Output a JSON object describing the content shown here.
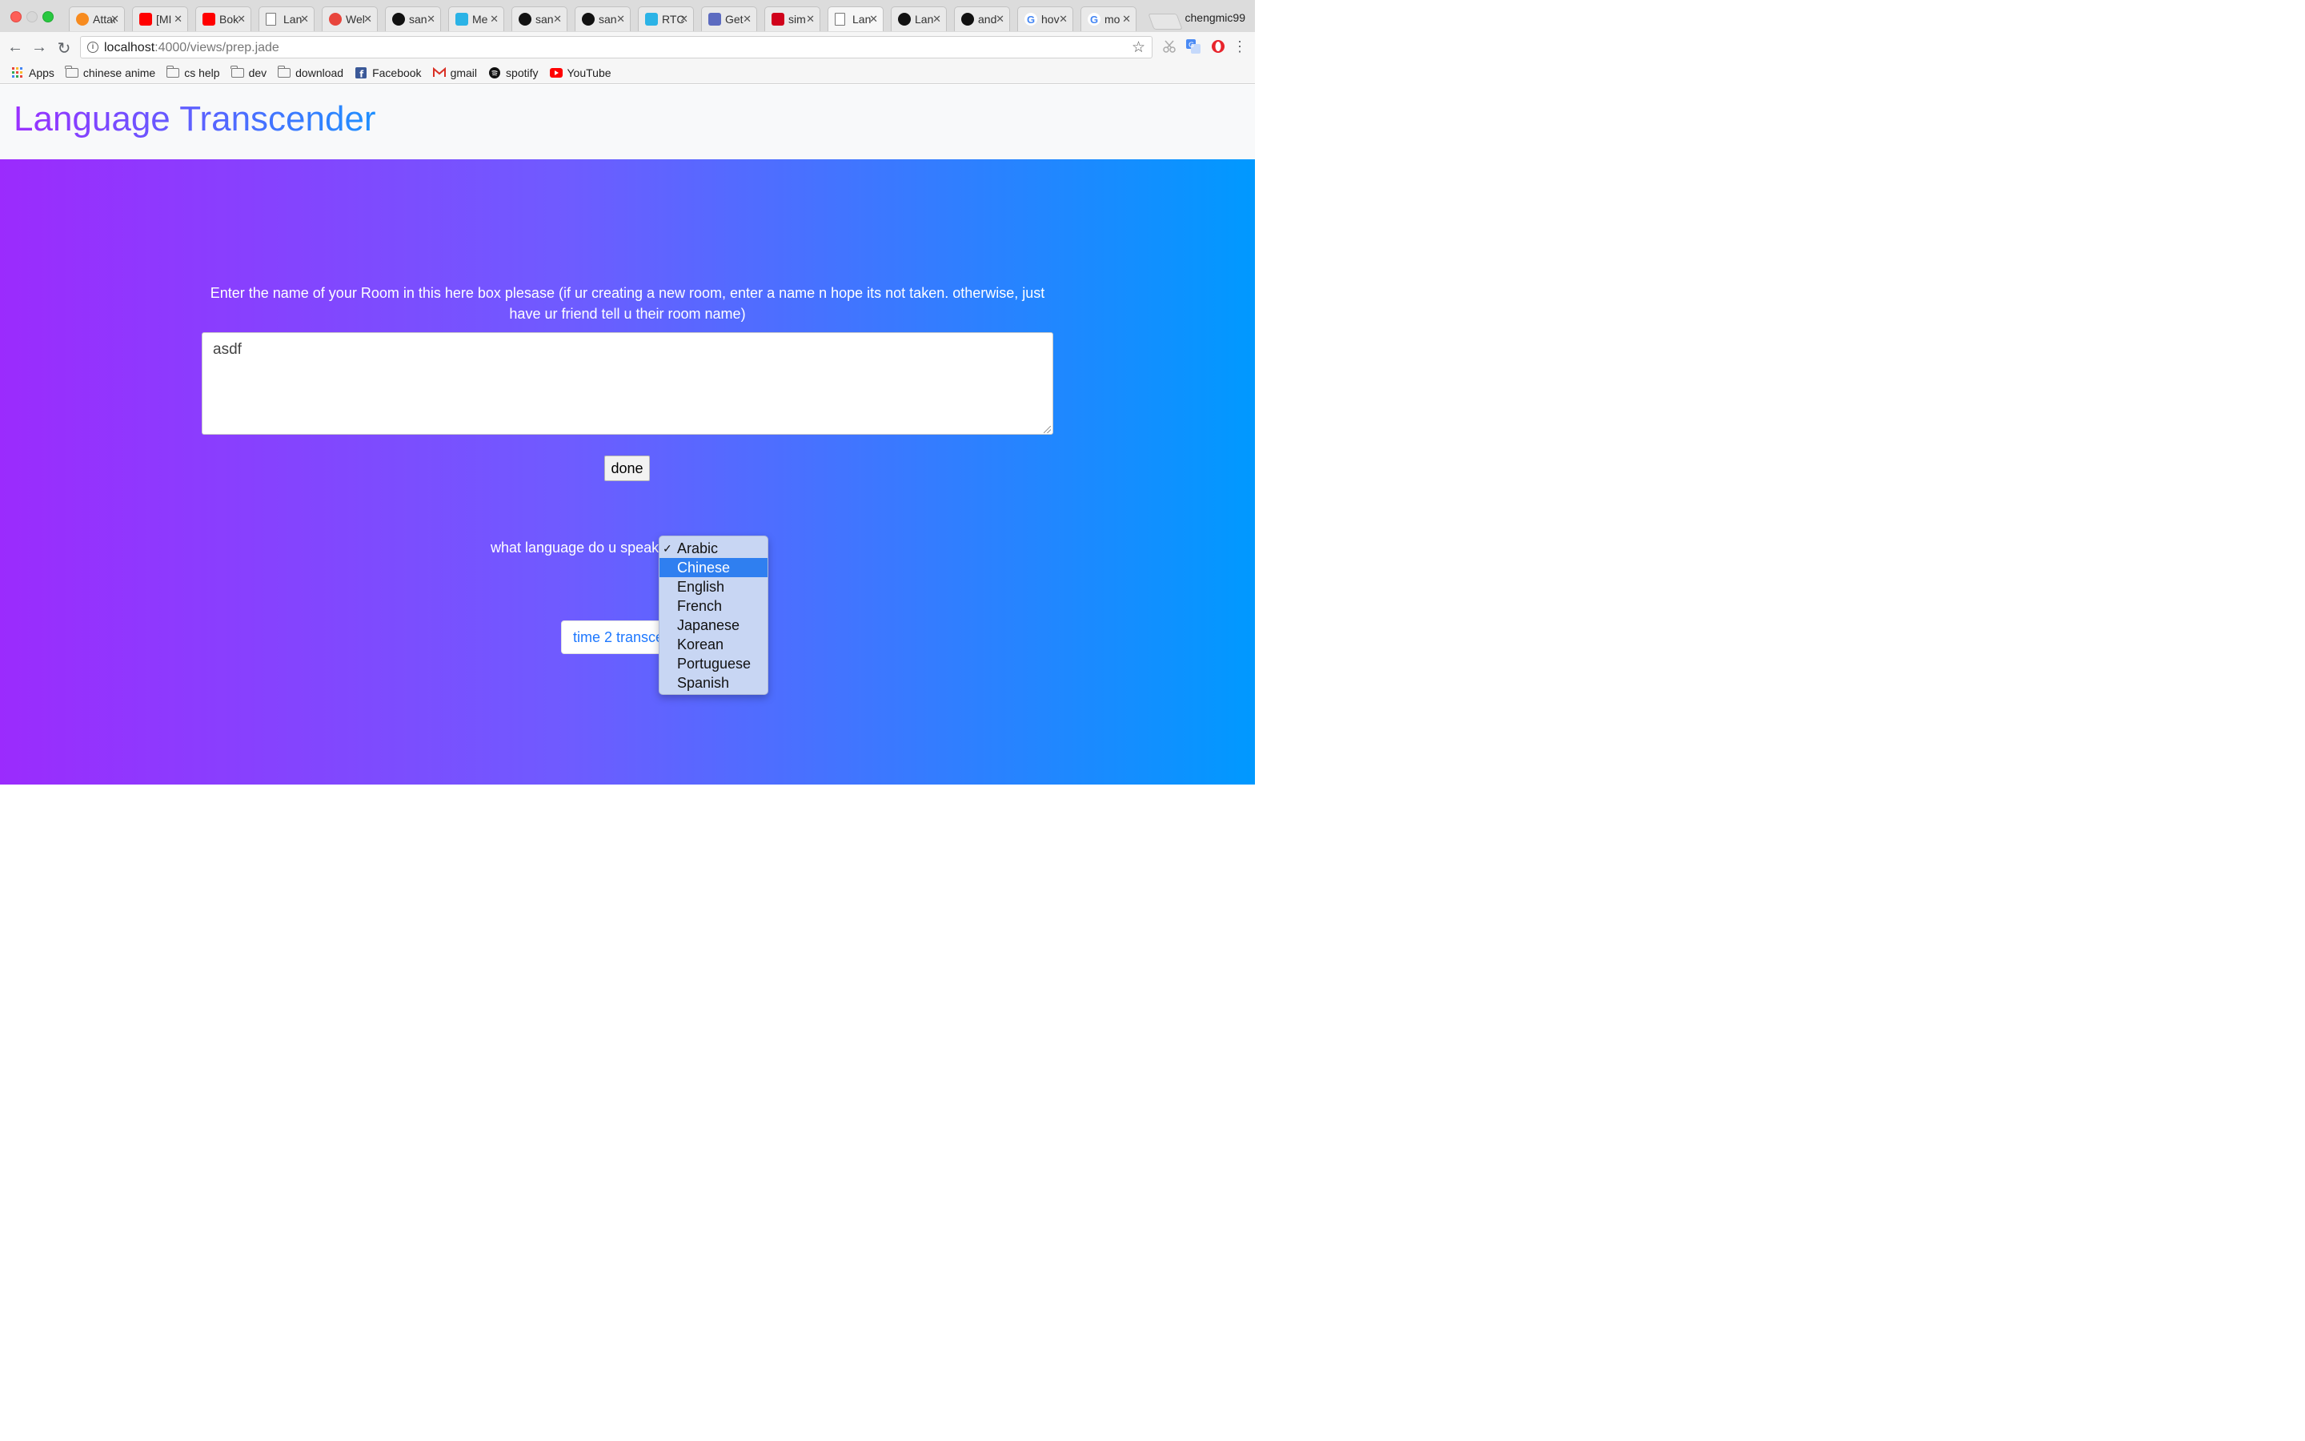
{
  "browser": {
    "profile_name": "chengmic99",
    "tabs": [
      {
        "title": "Attack",
        "icon": "crunchyroll-icon",
        "color": "#f78b1f"
      },
      {
        "title": "[MI",
        "icon": "youtube-icon",
        "color": "#ff0000"
      },
      {
        "title": "Bok",
        "icon": "youtube-icon",
        "color": "#ff0000"
      },
      {
        "title": "Lan",
        "icon": "document-icon",
        "color": "#ffffff"
      },
      {
        "title": "Wel",
        "icon": "webrtc-icon",
        "color": "#e8453c"
      },
      {
        "title": "san",
        "icon": "github-icon",
        "color": "#111111"
      },
      {
        "title": "Me",
        "icon": "bird-icon",
        "color": "#2bb3e6"
      },
      {
        "title": "san",
        "icon": "github-icon",
        "color": "#111111"
      },
      {
        "title": "san",
        "icon": "github-icon",
        "color": "#111111"
      },
      {
        "title": "RTC",
        "icon": "bird-icon",
        "color": "#2bb3e6"
      },
      {
        "title": "Get",
        "icon": "css3-icon",
        "color": "#5c6bc0"
      },
      {
        "title": "sim",
        "icon": "n-icon",
        "color": "#d0021b"
      },
      {
        "title": "Lan",
        "icon": "document-icon",
        "color": "#ffffff",
        "active": true
      },
      {
        "title": "Lan",
        "icon": "github-icon",
        "color": "#111111"
      },
      {
        "title": "and",
        "icon": "github-icon",
        "color": "#111111"
      },
      {
        "title": "hov",
        "icon": "google-icon",
        "color": "#4285f4"
      },
      {
        "title": "mo",
        "icon": "google-icon",
        "color": "#4285f4"
      }
    ],
    "url_host": "localhost",
    "url_path": ":4000/views/prep.jade",
    "bookmarks": {
      "apps": "Apps",
      "chinese_anime": "chinese anime",
      "cs_help": "cs help",
      "dev": "dev",
      "download": "download",
      "facebook": "Facebook",
      "gmail": "gmail",
      "spotify": "spotify",
      "youtube": "YouTube"
    }
  },
  "page": {
    "brand": "Language Transcender",
    "room_prompt": "Enter the name of your Room in this here box plesase (if ur creating a new room, enter a name n hope its not taken. otherwise, just have ur friend tell u their room name)",
    "room_value": "asdf",
    "done_label": "done",
    "language_label": "what language do u speak?",
    "go_label": "time 2 transcend",
    "language_options": [
      "Arabic",
      "Chinese",
      "English",
      "French",
      "Japanese",
      "Korean",
      "Portuguese",
      "Spanish"
    ],
    "selected_language": "Arabic",
    "highlighted_language": "Chinese",
    "gradient_colors": [
      "#9b2bfd",
      "#0099ff"
    ]
  }
}
